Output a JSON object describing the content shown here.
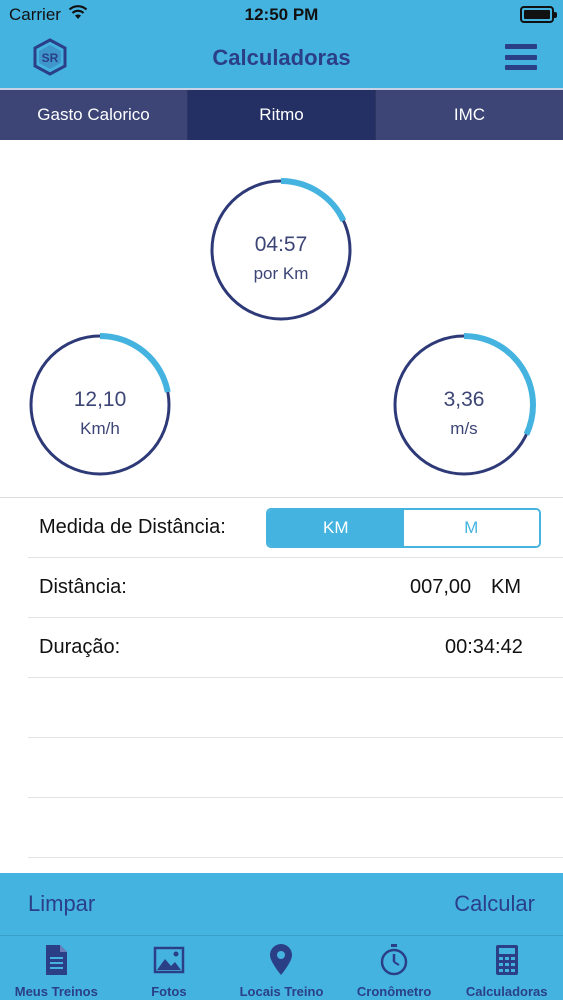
{
  "status_bar": {
    "carrier": "Carrier",
    "time": "12:50 PM"
  },
  "navbar": {
    "title": "Calculadoras"
  },
  "tabs": [
    {
      "label": "Gasto Calorico",
      "active": false
    },
    {
      "label": "Ritmo",
      "active": true
    },
    {
      "label": "IMC",
      "active": false
    }
  ],
  "gauges": {
    "pace": {
      "value": "04:57",
      "unit": "por Km",
      "progress": 0.18
    },
    "speed_kmh": {
      "value": "12,10",
      "unit": "Km/h",
      "progress": 0.22
    },
    "speed_ms": {
      "value": "3,36",
      "unit": "m/s",
      "progress": 0.32
    }
  },
  "form": {
    "distance_measure": {
      "label": "Medida de Distância:",
      "options": [
        "KM",
        "M"
      ],
      "selected": "KM"
    },
    "distance": {
      "label": "Distância:",
      "value": "007,00",
      "unit": "KM"
    },
    "duration": {
      "label": "Duração:",
      "value": "00:34:42"
    }
  },
  "actions": {
    "clear_label": "Limpar",
    "calculate_label": "Calcular"
  },
  "tabbar": [
    {
      "label": "Meus Treinos",
      "icon": "document-icon"
    },
    {
      "label": "Fotos",
      "icon": "photo-icon"
    },
    {
      "label": "Locais Treino",
      "icon": "map-pin-icon"
    },
    {
      "label": "Cronômetro",
      "icon": "stopwatch-icon"
    },
    {
      "label": "Calculadoras",
      "icon": "calculator-icon"
    }
  ],
  "colors": {
    "accent": "#45b3e0",
    "navy": "#2a3f86",
    "ring": "#3c4576"
  }
}
